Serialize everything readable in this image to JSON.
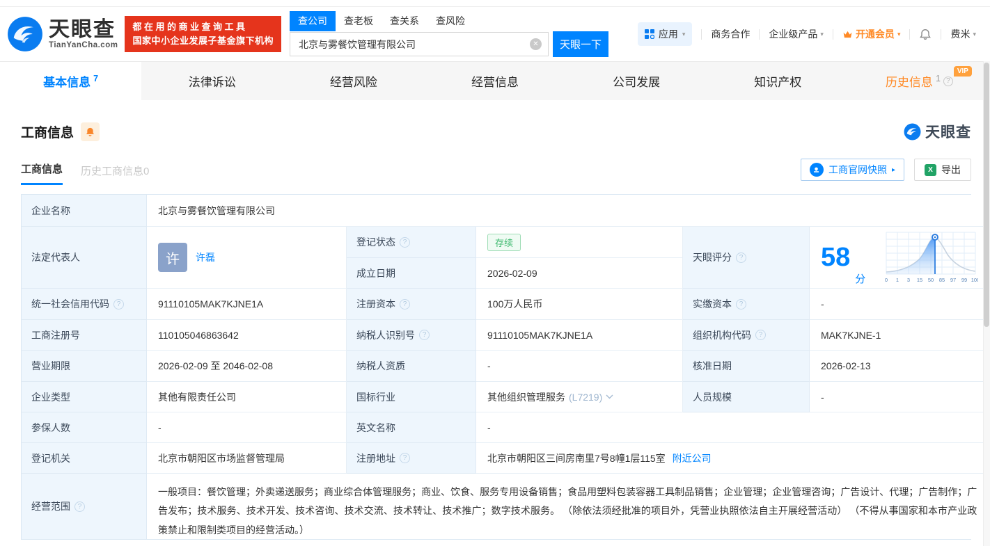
{
  "header": {
    "logo": {
      "title": "天眼查",
      "subtitle": "TianYanCha.com"
    },
    "promo": {
      "line1": "都在用的商业查询工具",
      "line2": "国家中小企业发展子基金旗下机构"
    },
    "search": {
      "tabs": [
        {
          "label": "查公司"
        },
        {
          "label": "查老板"
        },
        {
          "label": "查关系"
        },
        {
          "label": "查风险"
        }
      ],
      "value": "北京与雾餐饮管理有限公司",
      "button": "天眼一下"
    },
    "nav": {
      "apps": "应用",
      "cooperation": "商务合作",
      "enterprise": "企业级产品",
      "vip": "开通会员",
      "user": "费米"
    }
  },
  "tabs": [
    {
      "label": "基本信息",
      "count": "7"
    },
    {
      "label": "法律诉讼"
    },
    {
      "label": "经营风险"
    },
    {
      "label": "经营信息"
    },
    {
      "label": "公司发展"
    },
    {
      "label": "知识产权"
    },
    {
      "label": "历史信息",
      "count": "1",
      "badge": "VIP"
    }
  ],
  "section": {
    "title": "工商信息",
    "subtabs": [
      {
        "label": "工商信息"
      },
      {
        "label": "历史工商信息0"
      }
    ],
    "snapshot_button": "工商官网快照",
    "export_button": "导出",
    "watermark": "天眼查"
  },
  "biz": {
    "name": {
      "label": "企业名称",
      "value": "北京与雾餐饮管理有限公司"
    },
    "legal": {
      "label": "法定代表人",
      "avatar": "许",
      "name": "许磊"
    },
    "status": {
      "label": "登记状态",
      "value": "存续"
    },
    "established": {
      "label": "成立日期",
      "value": "2026-02-09"
    },
    "score": {
      "label": "天眼评分",
      "value": "58",
      "unit": "分",
      "axis": [
        "0",
        "1",
        "3",
        "15",
        "50",
        "85",
        "97",
        "99",
        "100"
      ]
    },
    "uscc": {
      "label": "统一社会信用代码",
      "value": "91110105MAK7KJNE1A"
    },
    "reg_capital": {
      "label": "注册资本",
      "value": "100万人民币"
    },
    "paid_capital": {
      "label": "实缴资本",
      "value": "-"
    },
    "reg_no": {
      "label": "工商注册号",
      "value": "110105046863642"
    },
    "tax_id": {
      "label": "纳税人识别号",
      "value": "91110105MAK7KJNE1A"
    },
    "org_code": {
      "label": "组织机构代码",
      "value": "MAK7KJNE-1"
    },
    "term": {
      "label": "营业期限",
      "value": "2026-02-09 至 2046-02-08"
    },
    "tax_qual": {
      "label": "纳税人资质",
      "value": "-"
    },
    "approval_date": {
      "label": "核准日期",
      "value": "2026-02-13"
    },
    "company_type": {
      "label": "企业类型",
      "value": "其他有限责任公司"
    },
    "industry": {
      "label": "国标行业",
      "value": "其他组织管理服务",
      "code": "(L7219)"
    },
    "staff_size": {
      "label": "人员规模",
      "value": "-"
    },
    "insured": {
      "label": "参保人数",
      "value": "-"
    },
    "english_name": {
      "label": "英文名称",
      "value": "-"
    },
    "authority": {
      "label": "登记机关",
      "value": "北京市朝阳区市场监督管理局"
    },
    "address": {
      "label": "注册地址",
      "value": "北京市朝阳区三间房南里7号8幢1层115室",
      "link": "附近公司"
    },
    "scope": {
      "label": "经营范围",
      "value": "一般项目：餐饮管理；外卖递送服务；商业综合体管理服务；商业、饮食、服务专用设备销售；食品用塑料包装容器工具制品销售；企业管理；企业管理咨询；广告设计、代理；广告制作；广告发布；技术服务、技术开发、技术咨询、技术交流、技术转让、技术推广；数字技术服务。 （除依法须经批准的项目外，凭营业执照依法自主开展经营活动） （不得从事国家和本市产业政策禁止和限制类项目的经营活动。）"
    }
  },
  "icons": {
    "help": "?",
    "caret": "▾",
    "clear": "✕",
    "arrow": "▸",
    "excel_x": "X"
  },
  "colors": {
    "accent": "#0084ff",
    "promo_red": "#e5341c",
    "vip_orange": "#ff8a26",
    "status_green": "#3cb96d",
    "label_bg": "#eef6fd",
    "table_border": "#dbe8f3"
  }
}
